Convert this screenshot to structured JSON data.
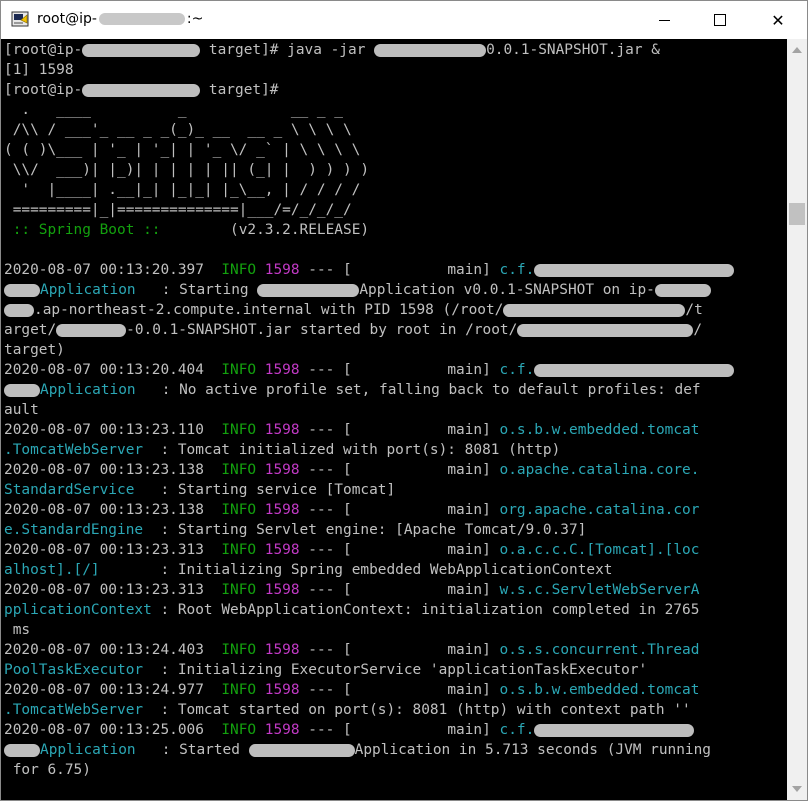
{
  "window": {
    "title_prefix": "root@ip-",
    "title_suffix": ":~",
    "minimize_glyph": "—",
    "maximize_glyph": "☐",
    "close_glyph": "✕"
  },
  "colors": {
    "background": "#000000",
    "text": "#c0c0c0",
    "info": "#13a10e",
    "pid": "#c239c6",
    "logger": "#2ba7b5"
  },
  "lines": [
    {
      "segs": [
        {
          "t": "[root@ip-"
        },
        {
          "blur": 118
        },
        {
          "t": " target]# java -jar "
        },
        {
          "blur": 112
        },
        {
          "t": "0.0.1-SNAPSHOT.jar &"
        }
      ]
    },
    {
      "segs": [
        {
          "t": "[1] 1598"
        }
      ]
    },
    {
      "segs": [
        {
          "t": "[root@ip-"
        },
        {
          "blur": 118
        },
        {
          "t": " target]#"
        }
      ]
    },
    {
      "segs": [
        {
          "t": "  .   ____          _            __ _ _"
        }
      ]
    },
    {
      "segs": [
        {
          "t": " /\\\\ / ___'_ __ _ _(_)_ __  __ _ \\ \\ \\ \\"
        }
      ]
    },
    {
      "segs": [
        {
          "t": "( ( )\\___ | '_ | '_| | '_ \\/ _` | \\ \\ \\ \\"
        }
      ]
    },
    {
      "segs": [
        {
          "t": " \\\\/  ___)| |_)| | | | | || (_| |  ) ) ) )"
        }
      ]
    },
    {
      "segs": [
        {
          "t": "  '  |____| .__|_| |_|_| |_\\__, | / / / /"
        }
      ]
    },
    {
      "segs": [
        {
          "t": " =========|_|==============|___/=/_/_/_/"
        }
      ]
    },
    {
      "segs": [
        {
          "t": " :: Spring Boot :: ",
          "c": "green"
        },
        {
          "t": "       (v2.3.2.RELEASE)"
        }
      ]
    },
    {
      "segs": [
        {
          "t": ""
        }
      ]
    },
    {
      "segs": [
        {
          "t": "2020-08-07 00:13:20.397  "
        },
        {
          "t": "INFO",
          "c": "green"
        },
        {
          "t": " "
        },
        {
          "t": "1598",
          "c": "magenta"
        },
        {
          "t": " --- [           main] "
        },
        {
          "t": "c.f.",
          "c": "cyan"
        },
        {
          "blur": 200
        }
      ]
    },
    {
      "segs": [
        {
          "blur": 36
        },
        {
          "t": "Application",
          "c": "cyan"
        },
        {
          "t": "   : Starting "
        },
        {
          "blur": 102
        },
        {
          "t": "Application v0.0.1-SNAPSHOT on ip-"
        },
        {
          "blur": 56
        }
      ]
    },
    {
      "segs": [
        {
          "blur": 30
        },
        {
          "t": ".ap-northeast-2.compute.internal with PID 1598 (/root/"
        },
        {
          "blur": 182
        },
        {
          "t": "/t"
        }
      ]
    },
    {
      "segs": [
        {
          "t": "arget/"
        },
        {
          "blur": 70
        },
        {
          "t": "-0.0.1-SNAPSHOT.jar started by root in /root/"
        },
        {
          "blur": 176
        },
        {
          "t": "/"
        }
      ]
    },
    {
      "segs": [
        {
          "t": "target)"
        }
      ]
    },
    {
      "segs": [
        {
          "t": "2020-08-07 00:13:20.404  "
        },
        {
          "t": "INFO",
          "c": "green"
        },
        {
          "t": " "
        },
        {
          "t": "1598",
          "c": "magenta"
        },
        {
          "t": " --- [           main] "
        },
        {
          "t": "c.f.",
          "c": "cyan"
        },
        {
          "blur": 200
        }
      ]
    },
    {
      "segs": [
        {
          "blur": 36
        },
        {
          "t": "Application",
          "c": "cyan"
        },
        {
          "t": "   : No active profile set, falling back to default profiles: def"
        }
      ]
    },
    {
      "segs": [
        {
          "t": "ault"
        }
      ]
    },
    {
      "segs": [
        {
          "t": "2020-08-07 00:13:23.110  "
        },
        {
          "t": "INFO",
          "c": "green"
        },
        {
          "t": " "
        },
        {
          "t": "1598",
          "c": "magenta"
        },
        {
          "t": " --- [           main] "
        },
        {
          "t": "o.s.b.w.embedded.tomcat",
          "c": "cyan"
        }
      ]
    },
    {
      "segs": [
        {
          "t": ".TomcatWebServer",
          "c": "cyan"
        },
        {
          "t": "  : Tomcat initialized with port(s): 8081 (http)"
        }
      ]
    },
    {
      "segs": [
        {
          "t": "2020-08-07 00:13:23.138  "
        },
        {
          "t": "INFO",
          "c": "green"
        },
        {
          "t": " "
        },
        {
          "t": "1598",
          "c": "magenta"
        },
        {
          "t": " --- [           main] "
        },
        {
          "t": "o.apache.catalina.core.",
          "c": "cyan"
        }
      ]
    },
    {
      "segs": [
        {
          "t": "StandardService",
          "c": "cyan"
        },
        {
          "t": "   : Starting service [Tomcat]"
        }
      ]
    },
    {
      "segs": [
        {
          "t": "2020-08-07 00:13:23.138  "
        },
        {
          "t": "INFO",
          "c": "green"
        },
        {
          "t": " "
        },
        {
          "t": "1598",
          "c": "magenta"
        },
        {
          "t": " --- [           main] "
        },
        {
          "t": "org.apache.catalina.cor",
          "c": "cyan"
        }
      ]
    },
    {
      "segs": [
        {
          "t": "e.StandardEngine",
          "c": "cyan"
        },
        {
          "t": "  : Starting Servlet engine: [Apache Tomcat/9.0.37]"
        }
      ]
    },
    {
      "segs": [
        {
          "t": "2020-08-07 00:13:23.313  "
        },
        {
          "t": "INFO",
          "c": "green"
        },
        {
          "t": " "
        },
        {
          "t": "1598",
          "c": "magenta"
        },
        {
          "t": " --- [           main] "
        },
        {
          "t": "o.a.c.c.C.[Tomcat].[loc",
          "c": "cyan"
        }
      ]
    },
    {
      "segs": [
        {
          "t": "alhost].[/]",
          "c": "cyan"
        },
        {
          "t": "       : Initializing Spring embedded WebApplicationContext"
        }
      ]
    },
    {
      "segs": [
        {
          "t": "2020-08-07 00:13:23.313  "
        },
        {
          "t": "INFO",
          "c": "green"
        },
        {
          "t": " "
        },
        {
          "t": "1598",
          "c": "magenta"
        },
        {
          "t": " --- [           main] "
        },
        {
          "t": "w.s.c.ServletWebServerA",
          "c": "cyan"
        }
      ]
    },
    {
      "segs": [
        {
          "t": "pplicationContext",
          "c": "cyan"
        },
        {
          "t": " : Root WebApplicationContext: initialization completed in 2765"
        }
      ]
    },
    {
      "segs": [
        {
          "t": " ms"
        }
      ]
    },
    {
      "segs": [
        {
          "t": "2020-08-07 00:13:24.403  "
        },
        {
          "t": "INFO",
          "c": "green"
        },
        {
          "t": " "
        },
        {
          "t": "1598",
          "c": "magenta"
        },
        {
          "t": " --- [           main] "
        },
        {
          "t": "o.s.s.concurrent.Thread",
          "c": "cyan"
        }
      ]
    },
    {
      "segs": [
        {
          "t": "PoolTaskExecutor",
          "c": "cyan"
        },
        {
          "t": "  : Initializing ExecutorService 'applicationTaskExecutor'"
        }
      ]
    },
    {
      "segs": [
        {
          "t": "2020-08-07 00:13:24.977  "
        },
        {
          "t": "INFO",
          "c": "green"
        },
        {
          "t": " "
        },
        {
          "t": "1598",
          "c": "magenta"
        },
        {
          "t": " --- [           main] "
        },
        {
          "t": "o.s.b.w.embedded.tomcat",
          "c": "cyan"
        }
      ]
    },
    {
      "segs": [
        {
          "t": ".TomcatWebServer",
          "c": "cyan"
        },
        {
          "t": "  : Tomcat started on port(s): 8081 (http) with context path ''"
        }
      ]
    },
    {
      "segs": [
        {
          "t": "2020-08-07 00:13:25.006  "
        },
        {
          "t": "INFO",
          "c": "green"
        },
        {
          "t": " "
        },
        {
          "t": "1598",
          "c": "magenta"
        },
        {
          "t": " --- [           main] "
        },
        {
          "t": "c.f.",
          "c": "cyan"
        },
        {
          "blur": 160
        }
      ]
    },
    {
      "segs": [
        {
          "blur": 36
        },
        {
          "t": "Application",
          "c": "cyan"
        },
        {
          "t": "   : Started "
        },
        {
          "blur": 106
        },
        {
          "t": "Application in 5.713 seconds (JVM running"
        }
      ]
    },
    {
      "segs": [
        {
          "t": " for 6.75)"
        }
      ]
    }
  ]
}
